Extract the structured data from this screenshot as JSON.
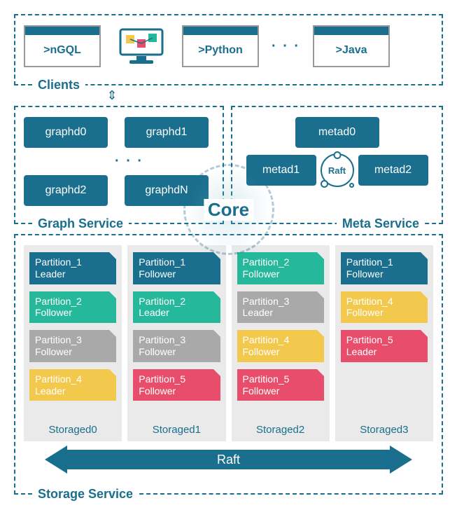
{
  "clients": {
    "label": "Clients",
    "items": [
      ">nGQL",
      ">Python",
      ">Java"
    ],
    "ellipsis": "· · ·"
  },
  "graph_service": {
    "label": "Graph Service",
    "nodes": [
      "graphd0",
      "graphd1",
      "graphd2",
      "graphdN"
    ],
    "ellipsis": "· · ·"
  },
  "meta_service": {
    "label": "Meta Service",
    "nodes": [
      "metad0",
      "metad1",
      "metad2"
    ],
    "raft_label": "Raft"
  },
  "core_label": "Core",
  "storage_service": {
    "label": "Storage Service",
    "raft_label": "Raft",
    "columns": [
      {
        "name": "Storaged0",
        "partitions": [
          {
            "title": "Partition_1",
            "role": "Leader",
            "color": "c-blue"
          },
          {
            "title": "Partition_2",
            "role": "Follower",
            "color": "c-teal"
          },
          {
            "title": "Partition_3",
            "role": "Follower",
            "color": "c-gray"
          },
          {
            "title": "Partition_4",
            "role": "Leader",
            "color": "c-yellow"
          }
        ]
      },
      {
        "name": "Storaged1",
        "partitions": [
          {
            "title": "Partition_1",
            "role": "Follower",
            "color": "c-blue"
          },
          {
            "title": "Partition_2",
            "role": "Leader",
            "color": "c-teal"
          },
          {
            "title": "Partition_3",
            "role": "Follower",
            "color": "c-gray"
          },
          {
            "title": "Partition_5",
            "role": "Follower",
            "color": "c-pink"
          }
        ]
      },
      {
        "name": "Storaged2",
        "partitions": [
          {
            "title": "Partition_2",
            "role": "Follower",
            "color": "c-teal"
          },
          {
            "title": "Partition_3",
            "role": "Leader",
            "color": "c-gray"
          },
          {
            "title": "Partition_4",
            "role": "Follower",
            "color": "c-yellow"
          },
          {
            "title": "Partition_5",
            "role": "Follower",
            "color": "c-pink"
          }
        ]
      },
      {
        "name": "Storaged3",
        "partitions": [
          {
            "title": "Partition_1",
            "role": "Follower",
            "color": "c-blue"
          },
          {
            "title": "Partition_4",
            "role": "Follower",
            "color": "c-yellow"
          },
          {
            "title": "Partition_5",
            "role": "Leader",
            "color": "c-pink"
          }
        ]
      }
    ]
  }
}
